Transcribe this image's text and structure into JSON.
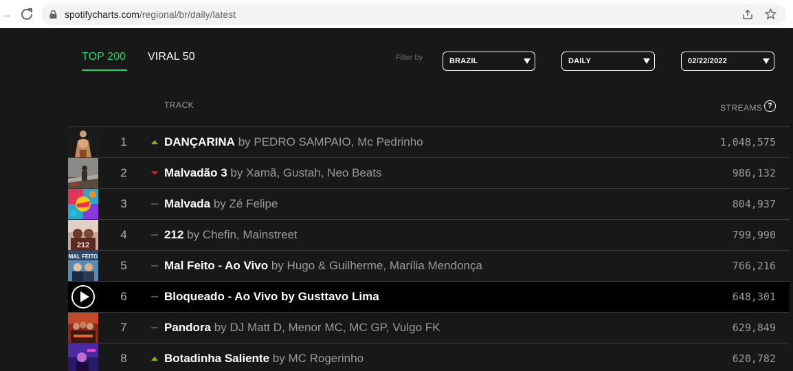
{
  "browser": {
    "url_host": "spotifycharts.com",
    "url_path": "/regional/br/daily/latest"
  },
  "tabs": [
    {
      "label": "TOP 200",
      "active": true
    },
    {
      "label": "VIRAL 50",
      "active": false
    }
  ],
  "filters": {
    "label": "Filter by",
    "country": "BRAZIL",
    "frequency": "DAILY",
    "date": "02/22/2022"
  },
  "table": {
    "track_header": "TRACK",
    "streams_header": "STREAMS",
    "help_symbol": "?",
    "rows": [
      {
        "rank": "1",
        "trend": "up",
        "title": "DANÇARINA",
        "artists": "by PEDRO SAMPAIO, Mc Pedrinho",
        "streams": "1,048,575"
      },
      {
        "rank": "2",
        "trend": "down",
        "title": "Malvadão 3",
        "artists": "by Xamã, Gustah, Neo Beats",
        "streams": "986,132"
      },
      {
        "rank": "3",
        "trend": "same",
        "title": "Malvada",
        "artists": "by Zé Felipe",
        "streams": "804,937"
      },
      {
        "rank": "4",
        "trend": "same",
        "title": "212",
        "artists": "by Chefin, Mainstreet",
        "streams": "799,990"
      },
      {
        "rank": "5",
        "trend": "same",
        "title": "Mal Feito - Ao Vivo",
        "artists": "by Hugo & Guilherme, Marília Mendonça",
        "streams": "766,216"
      },
      {
        "rank": "6",
        "trend": "same",
        "title": "Bloqueado - Ao Vivo",
        "artists": "by Gusttavo Lima",
        "streams": "648,301",
        "active": true
      },
      {
        "rank": "7",
        "trend": "same",
        "title": "Pandora",
        "artists": "by DJ Matt D, Menor MC, MC GP, Vulgo FK",
        "streams": "629,849"
      },
      {
        "rank": "8",
        "trend": "up",
        "title": "Botadinha Saliente",
        "artists": "by MC Rogerinho",
        "streams": "620,782"
      }
    ]
  },
  "colors": {
    "accent": "#1ed760",
    "trend_up": "#84bd00",
    "trend_down": "#cd1a2b",
    "trend_same": "#535353"
  }
}
